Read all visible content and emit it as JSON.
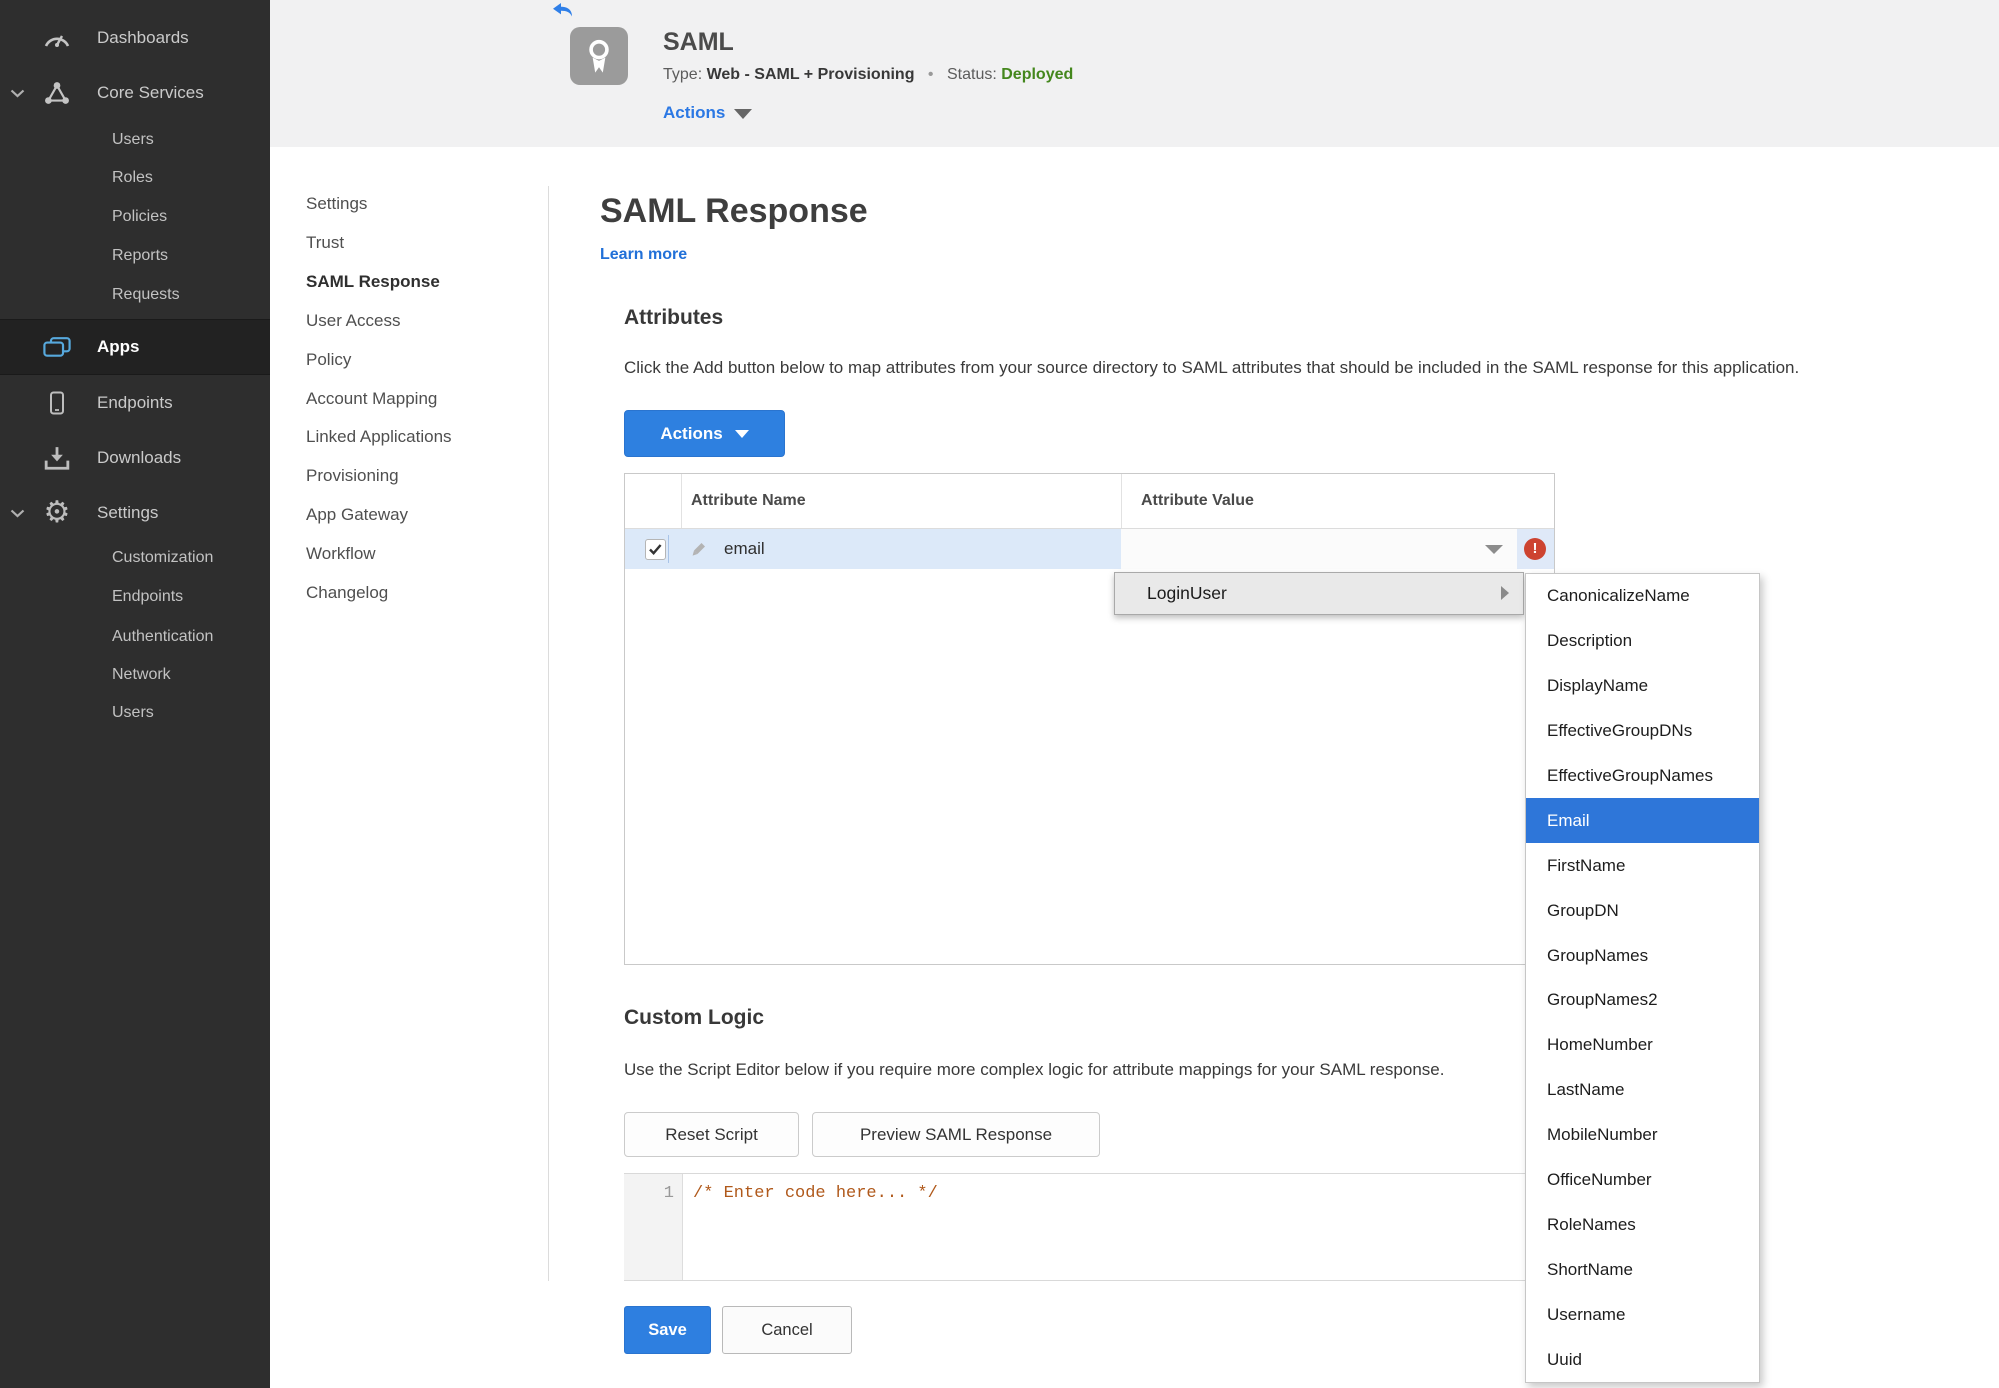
{
  "colors": {
    "accent_blue": "#2e7fe0",
    "link_blue": "#2b78e4",
    "status_green": "#44871d",
    "selected_row": "#dce9f9",
    "error_red": "#cd4330",
    "submenu_selected": "#2e76d9"
  },
  "sidebar": {
    "items": [
      {
        "label": "Dashboards",
        "icon": "gauge",
        "type": "top"
      },
      {
        "label": "Core Services",
        "icon": "core",
        "type": "top",
        "chevron": true
      },
      {
        "label": "Users",
        "type": "sub"
      },
      {
        "label": "Roles",
        "type": "sub"
      },
      {
        "label": "Policies",
        "type": "sub"
      },
      {
        "label": "Reports",
        "type": "sub"
      },
      {
        "label": "Requests",
        "type": "sub"
      },
      {
        "label": "Apps",
        "icon": "apps",
        "type": "top",
        "selected": true
      },
      {
        "label": "Endpoints",
        "icon": "endpoint",
        "type": "top"
      },
      {
        "label": "Downloads",
        "icon": "download",
        "type": "top"
      },
      {
        "label": "Settings",
        "icon": "gear",
        "type": "top",
        "chevron": true
      },
      {
        "label": "Customization",
        "type": "sub"
      },
      {
        "label": "Endpoints",
        "type": "sub"
      },
      {
        "label": "Authentication",
        "type": "sub"
      },
      {
        "label": "Network",
        "type": "sub"
      },
      {
        "label": "Users",
        "type": "sub"
      }
    ]
  },
  "header": {
    "title": "SAML",
    "type_label": "Type:",
    "type_value": "Web - SAML + Provisioning",
    "separator": "•",
    "status_label": "Status:",
    "status_value": "Deployed",
    "actions_label": "Actions"
  },
  "subnav": {
    "items": [
      {
        "label": "Settings"
      },
      {
        "label": "Trust"
      },
      {
        "label": "SAML Response",
        "selected": true
      },
      {
        "label": "User Access"
      },
      {
        "label": "Policy"
      },
      {
        "label": "Account Mapping"
      },
      {
        "label": "Linked Applications"
      },
      {
        "label": "Provisioning"
      },
      {
        "label": "App Gateway"
      },
      {
        "label": "Workflow"
      },
      {
        "label": "Changelog"
      }
    ]
  },
  "main": {
    "title": "SAML Response",
    "learn_more": "Learn more",
    "attributes": {
      "heading": "Attributes",
      "description": "Click the Add button below to map attributes from your source directory to SAML attributes that should be included in the SAML response for this application.",
      "actions_button": "Actions",
      "table": {
        "columns": [
          "Attribute Name",
          "Attribute Value"
        ],
        "rows": [
          {
            "name": "email",
            "value": "",
            "checked": true,
            "error": true
          }
        ]
      }
    },
    "custom_logic": {
      "heading": "Custom Logic",
      "description": "Use the Script Editor below if you require more complex logic for attribute mappings for your SAML response.",
      "reset_button": "Reset Script",
      "preview_button": "Preview SAML Response",
      "editor": {
        "line_number": "1",
        "code": "/* Enter code here... */"
      }
    },
    "save_button": "Save",
    "cancel_button": "Cancel"
  },
  "menu": {
    "label": "LoginUser"
  },
  "submenu": {
    "selected": "Email",
    "items": [
      "CanonicalizeName",
      "Description",
      "DisplayName",
      "EffectiveGroupDNs",
      "EffectiveGroupNames",
      "Email",
      "FirstName",
      "GroupDN",
      "GroupNames",
      "GroupNames2",
      "HomeNumber",
      "LastName",
      "MobileNumber",
      "OfficeNumber",
      "RoleNames",
      "ShortName",
      "Username",
      "Uuid"
    ]
  }
}
